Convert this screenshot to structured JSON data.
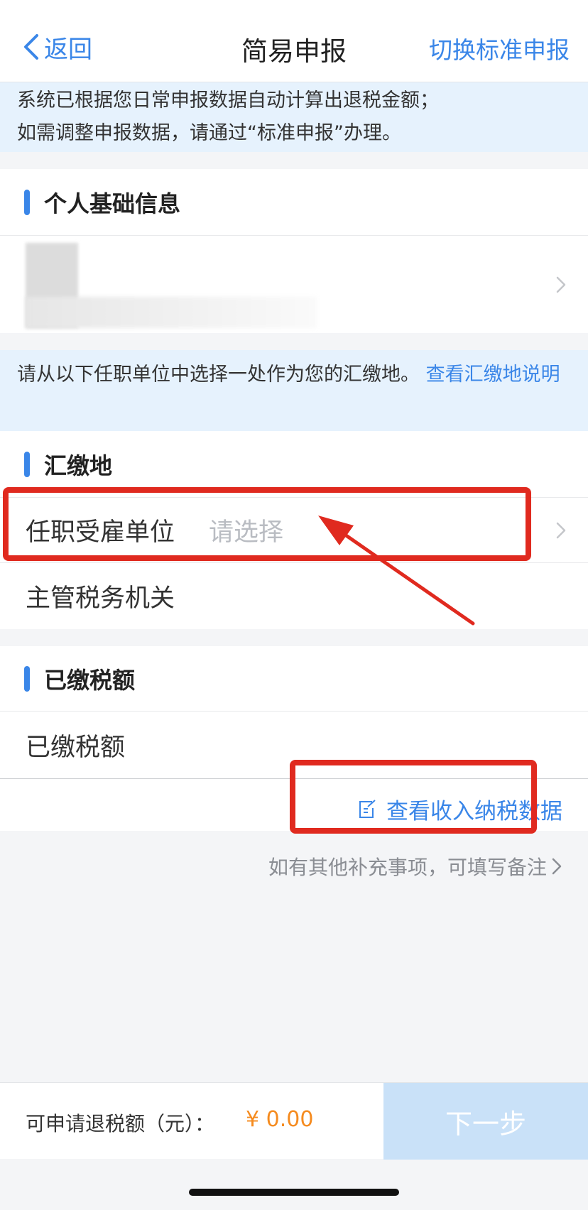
{
  "nav": {
    "back_label": "返回",
    "title": "简易申报",
    "switch_label": "切换标准申报"
  },
  "notice_top": {
    "line1": "系统已根据您日常申报数据自动计算出退税金额；",
    "line2": "如需调整申报数据，请通过“标准申报”办理。"
  },
  "personal_info": {
    "heading": "个人基础信息"
  },
  "notice_place": {
    "text": "请从以下任职单位中选择一处作为您的汇缴地。",
    "link": "查看汇缴地说明"
  },
  "payment_place": {
    "heading": "汇缴地",
    "employer_label": "任职受雇单位",
    "employer_placeholder": "请选择",
    "tax_office_label": "主管税务机关"
  },
  "paid_tax": {
    "heading": "已缴税额",
    "row_label": "已缴税额",
    "view_data_label": "查看收入纳税数据"
  },
  "remark": {
    "label": "如有其他补充事项，可填写备注"
  },
  "footer": {
    "refund_label": "可申请退税额（元）：",
    "refund_amount": "¥ 0.00",
    "next_button": "下一步"
  },
  "colors": {
    "accent": "#3a86e8",
    "amount": "#f58b1f",
    "highlight": "#e02a1f",
    "notice_bg": "#e6f2fd"
  }
}
